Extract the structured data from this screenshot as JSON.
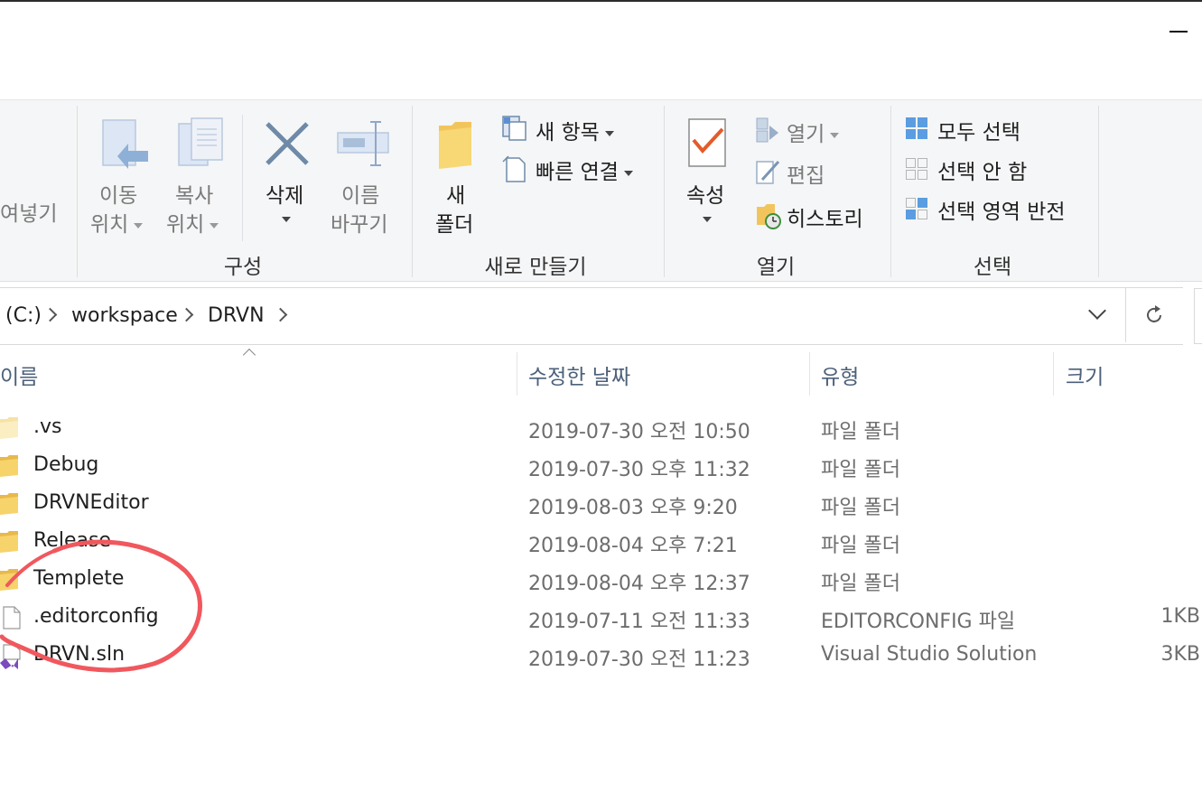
{
  "ribbon": {
    "paste_partial": "여넣기",
    "move_to": {
      "line1": "이동",
      "line2": "위치"
    },
    "copy_to": {
      "line1": "복사",
      "line2": "위치"
    },
    "delete": "삭제",
    "rename": {
      "line1": "이름",
      "line2": "바꾸기"
    },
    "new_folder": {
      "line1": "새",
      "line2": "폴더"
    },
    "new_item": "새 항목",
    "easy_access": "빠른 연결",
    "properties": "속성",
    "open": "열기",
    "edit": "편집",
    "history": "히스토리",
    "select_all": "모두 선택",
    "select_none": "선택 안 함",
    "invert_selection": "선택 영역 반전",
    "groups": {
      "organize": "구성",
      "new": "새로 만들기",
      "open": "열기",
      "select": "선택"
    }
  },
  "address": {
    "drive": "(C:)",
    "crumb1": "workspace",
    "crumb2": "DRVN"
  },
  "columns": {
    "name": "이름",
    "date": "수정한 날짜",
    "type": "유형",
    "size": "크기"
  },
  "files": [
    {
      "name": ".vs",
      "date": "2019-07-30 오전 10:50",
      "type": "파일 폴더",
      "size": "",
      "kind": "folder-icon"
    },
    {
      "name": "Debug",
      "date": "2019-07-30 오후 11:32",
      "type": "파일 폴더",
      "size": "",
      "kind": "folder-icon"
    },
    {
      "name": "DRVNEditor",
      "date": "2019-08-03 오후 9:20",
      "type": "파일 폴더",
      "size": "",
      "kind": "folder-icon"
    },
    {
      "name": "Release",
      "date": "2019-08-04 오후 7:21",
      "type": "파일 폴더",
      "size": "",
      "kind": "folder-icon"
    },
    {
      "name": "Templete",
      "date": "2019-08-04 오후 12:37",
      "type": "파일 폴더",
      "size": "",
      "kind": "folder-icon"
    },
    {
      "name": ".editorconfig",
      "date": "2019-07-11 오전 11:33",
      "type": "EDITORCONFIG 파일",
      "size": "1KB",
      "kind": "file-icon"
    },
    {
      "name": "DRVN.sln",
      "date": "2019-07-30 오전 11:23",
      "type": "Visual Studio Solution",
      "size": "3KB",
      "kind": "vs-solution-icon"
    }
  ],
  "colors": {
    "annotation": "#f0585e",
    "folder": "#f7d36b",
    "header_text": "#4c607a",
    "accent": "#2b7fd6"
  }
}
